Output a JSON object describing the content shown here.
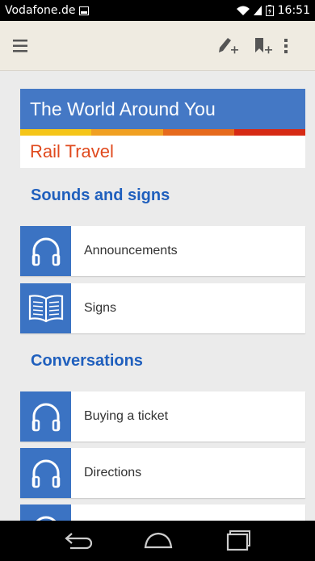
{
  "status_bar": {
    "carrier": "Vodafone.de",
    "time": "16:51"
  },
  "action_bar": {
    "menu_icon": "hamburger-menu-icon",
    "add_note_icon": "pencil-plus-icon",
    "add_bookmark_icon": "bookmark-plus-icon",
    "overflow_icon": "more-vert-icon"
  },
  "title_card": {
    "title": "The World Around You",
    "subtitle": "Rail Travel",
    "stripe_colors": [
      "#f5c518",
      "#f0a022",
      "#e66a1d",
      "#d62a14"
    ]
  },
  "sections": [
    {
      "heading": "Sounds and signs",
      "items": [
        {
          "label": "Announcements",
          "icon": "headphones-icon"
        },
        {
          "label": "Signs",
          "icon": "book-icon"
        }
      ]
    },
    {
      "heading": "Conversations",
      "items": [
        {
          "label": "Buying a ticket",
          "icon": "headphones-icon"
        },
        {
          "label": "Directions",
          "icon": "headphones-icon"
        }
      ]
    }
  ],
  "colors": {
    "accent": "#4478c5",
    "heading": "#1f5fbd",
    "subtitle": "#e04a1e",
    "tile": "#3b73c3"
  }
}
